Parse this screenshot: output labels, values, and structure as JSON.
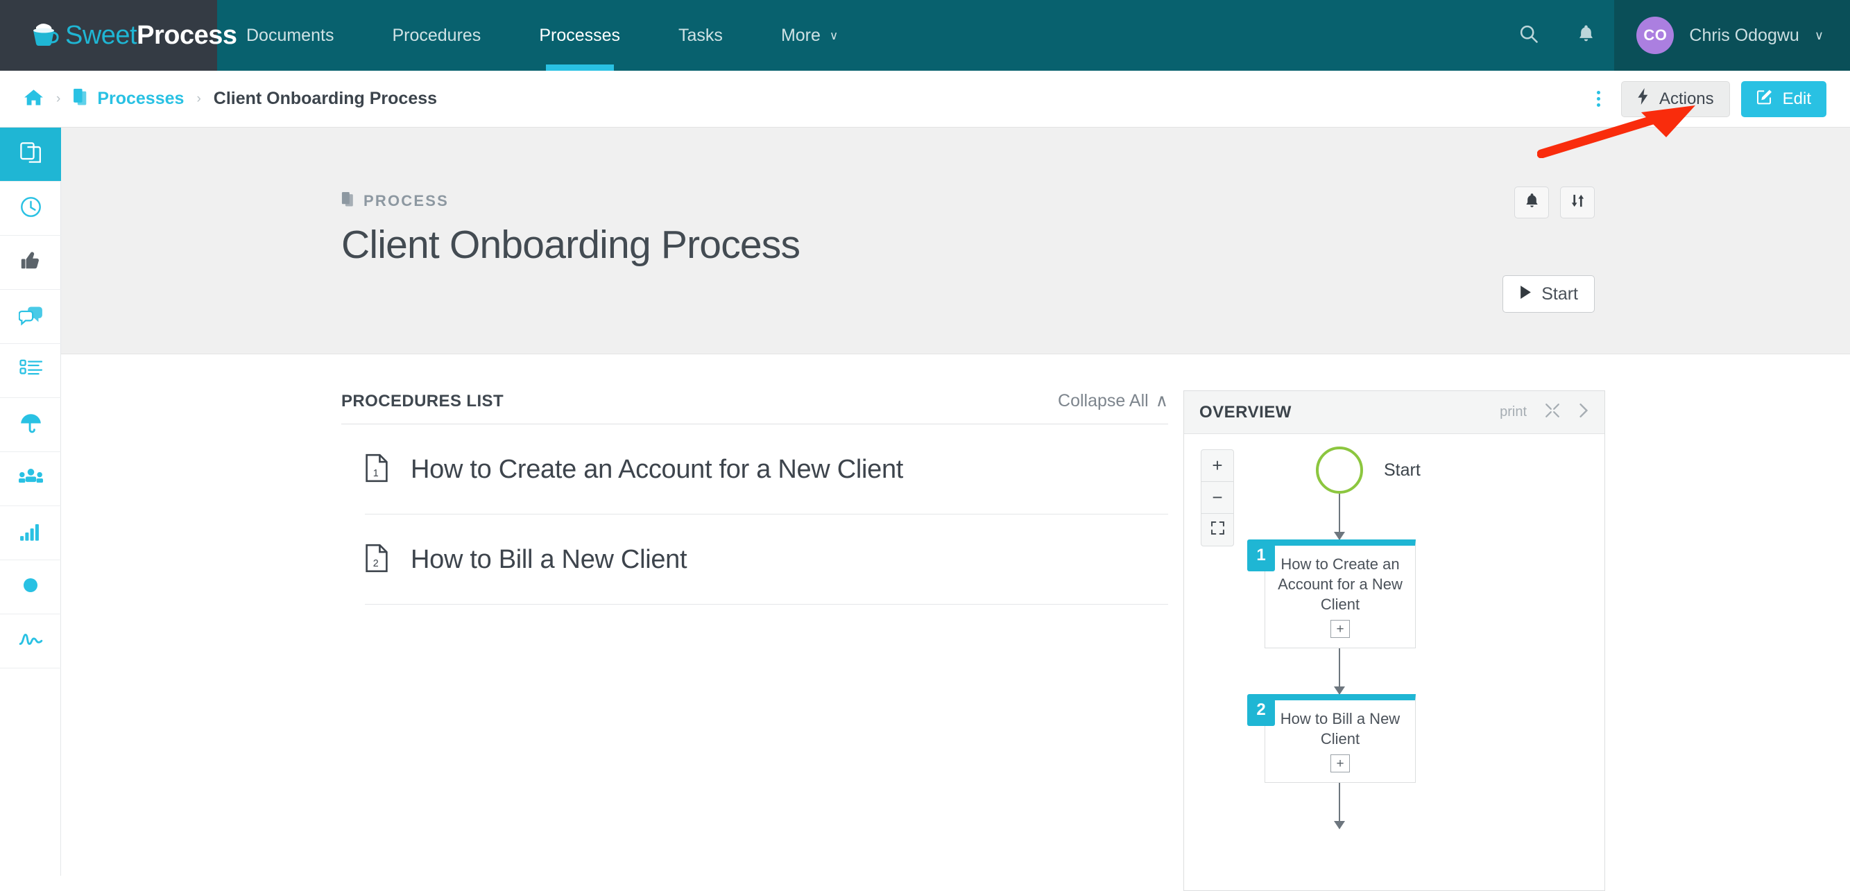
{
  "brand": {
    "name_part1": "Sweet",
    "name_part2": "Process",
    "logo_icon": "sweetprocess-cup-logo"
  },
  "topnav": {
    "items": [
      {
        "label": "Documents",
        "active": false
      },
      {
        "label": "Procedures",
        "active": false
      },
      {
        "label": "Processes",
        "active": true
      },
      {
        "label": "Tasks",
        "active": false
      },
      {
        "label": "More",
        "active": false,
        "caret": "∨"
      }
    ],
    "search_icon": "search-icon",
    "bell_icon": "bell-icon",
    "user": {
      "initials": "CO",
      "name": "Chris Odogwu",
      "caret": "∨"
    }
  },
  "breadcrumb": {
    "home_icon": "home-icon",
    "separator": "›",
    "parent_label": "Processes",
    "parent_icon": "pages-icon",
    "current_label": "Client Onboarding Process",
    "kebab_icon": "vertical-dots-icon",
    "actions_label": "Actions",
    "actions_icon": "lightning-bolt-icon",
    "edit_label": "Edit",
    "edit_icon": "edit-pencil-icon"
  },
  "sidebar": {
    "items": [
      {
        "icon": "pages-copy-icon",
        "active": true
      },
      {
        "icon": "clock-icon",
        "active": false
      },
      {
        "icon": "thumbs-up-icon",
        "active": false
      },
      {
        "icon": "chat-bubbles-icon",
        "active": false
      },
      {
        "icon": "checklist-icon",
        "active": false
      },
      {
        "icon": "umbrella-icon",
        "active": false
      },
      {
        "icon": "teams-icon",
        "active": false
      },
      {
        "icon": "bar-chart-icon",
        "active": false
      },
      {
        "icon": "circle-dot-icon",
        "active": false
      },
      {
        "icon": "signature-squiggle-icon",
        "active": false
      }
    ]
  },
  "page_header": {
    "eyebrow": "PROCESS",
    "eyebrow_icon": "pages-icon",
    "title": "Client Onboarding Process",
    "bell_icon": "bell-icon",
    "sort_icon": "sort-arrows-icon",
    "start_label": "Start",
    "start_icon": "play-icon"
  },
  "procedures_panel": {
    "heading": "PROCEDURES LIST",
    "collapse_label": "Collapse All",
    "collapse_caret": "∧",
    "items": [
      {
        "number": "1",
        "title": "How to Create an Account for a New Client",
        "icon": "document-numbered-icon"
      },
      {
        "number": "2",
        "title": "How to Bill a New Client",
        "icon": "document-numbered-icon"
      }
    ]
  },
  "overview_panel": {
    "heading": "OVERVIEW",
    "print_label": "print",
    "expand_icon": "expand-collapse-icon",
    "next_icon": "chevron-right-icon",
    "zoom_in": "+",
    "zoom_out": "−",
    "fit_icon": "fit-to-screen-icon",
    "flow": {
      "start_label": "Start",
      "start_node_color": "#8cc63f",
      "node_accent_color": "#1fb6d4",
      "nodes": [
        {
          "number": "1",
          "text": "How to Create an Account for a New Client",
          "expand": "+"
        },
        {
          "number": "2",
          "text": "How to Bill a New Client",
          "expand": "+"
        }
      ]
    }
  },
  "annotation": {
    "arrow_color": "#f92c0c",
    "arrow_name": "red-pointer-arrow"
  },
  "colors": {
    "nav_teal": "#08616e",
    "logo_dark": "#343b44",
    "accent_cyan": "#29c1e3",
    "avatar_purple": "#ab7fe0",
    "header_bg": "#f0f0f0",
    "green": "#8cc63f"
  }
}
